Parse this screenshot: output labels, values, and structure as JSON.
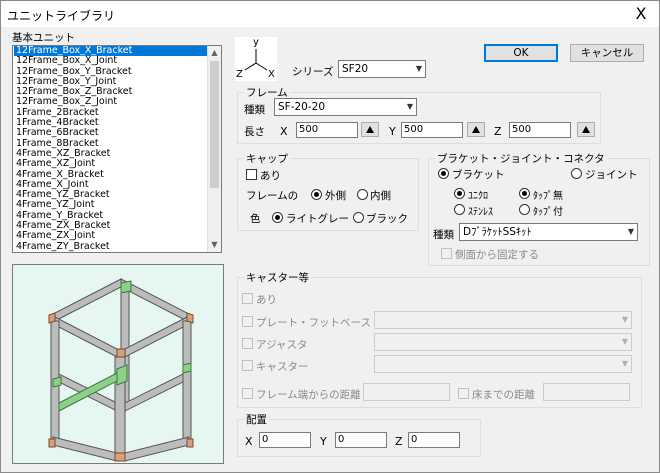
{
  "window": {
    "title": "ユニットライブラリ",
    "close_glyph": "X"
  },
  "library": {
    "label": "基本ユニット",
    "items": [
      "12Frame_Box_X_Bracket",
      "12Frame_Box_X_Joint",
      "12Frame_Box_Y_Bracket",
      "12Frame_Box_Y_Joint",
      "12Frame_Box_Z_Bracket",
      "12Frame_Box_Z_Joint",
      "1Frame_2Bracket",
      "1Frame_4Bracket",
      "1Frame_6Bracket",
      "1Frame_8Bracket",
      "4Frame_XZ_Bracket",
      "4Frame_XZ_Joint",
      "4Frame_X_Bracket",
      "4Frame_X_Joint",
      "4Frame_YZ_Bracket",
      "4Frame_YZ_Joint",
      "4Frame_Y_Bracket",
      "4Frame_ZX_Bracket",
      "4Frame_ZX_Joint",
      "4Frame_ZY_Bracket",
      "4Frame_ZY_Joint"
    ],
    "selected_index": 0
  },
  "axes": {
    "y": "y",
    "x": "X",
    "z": "Z"
  },
  "series": {
    "label": "シリーズ",
    "value": "SF20"
  },
  "buttons": {
    "ok": "OK",
    "cancel": "キャンセル"
  },
  "frame": {
    "title": "フレーム",
    "type_label": "種類",
    "type_value": "SF-20-20",
    "length_label": "長さ",
    "x_label": "X",
    "x_value": "500",
    "y_label": "Y",
    "y_value": "500",
    "z_label": "Z",
    "z_value": "500"
  },
  "cap": {
    "title": "キャップ",
    "enabled_label": "あり",
    "enabled": false,
    "side_label": "フレームの",
    "outer": "外側",
    "inner": "内側",
    "side_selected": "outer",
    "color_label": "色",
    "light_gray": "ライトグレー",
    "black": "ブラック",
    "color_selected": "light_gray"
  },
  "connector": {
    "title": "ブラケット・ジョイント・コネクタ",
    "bracket": "ブラケット",
    "joint": "ジョイント",
    "kind_selected": "bracket",
    "unichrome": "ﾕﾆｸﾛ",
    "stainless": "ｽﾃﾝﾚｽ",
    "finish_selected": "unichrome",
    "tap_none": "ﾀｯﾌﾟ無",
    "tap_with": "ﾀｯﾌﾟ付",
    "tap_selected": "tap_none",
    "type_label": "種類",
    "type_value": "DﾌﾞﾗｹｯﾄSSｷｯﾄ",
    "side_fix_label": "側面から固定する"
  },
  "caster": {
    "title": "キャスター等",
    "enabled_label": "あり",
    "plate_label": "プレート・フットベース",
    "adjuster_label": "アジャスタ",
    "caster_label": "キャスター",
    "frame_dist_label": "フレーム端からの距離",
    "floor_dist_label": "床までの距離"
  },
  "placement": {
    "title": "配置",
    "x_label": "X",
    "x_value": "0",
    "y_label": "Y",
    "y_value": "0",
    "z_label": "Z",
    "z_value": "0"
  },
  "colors": {
    "selection": "#0078d7",
    "preview_bg": "#e6f7f2",
    "frame_gray": "#b9b9b9",
    "bracket_green": "#8ed08a",
    "joint_orange": "#d9a080"
  }
}
